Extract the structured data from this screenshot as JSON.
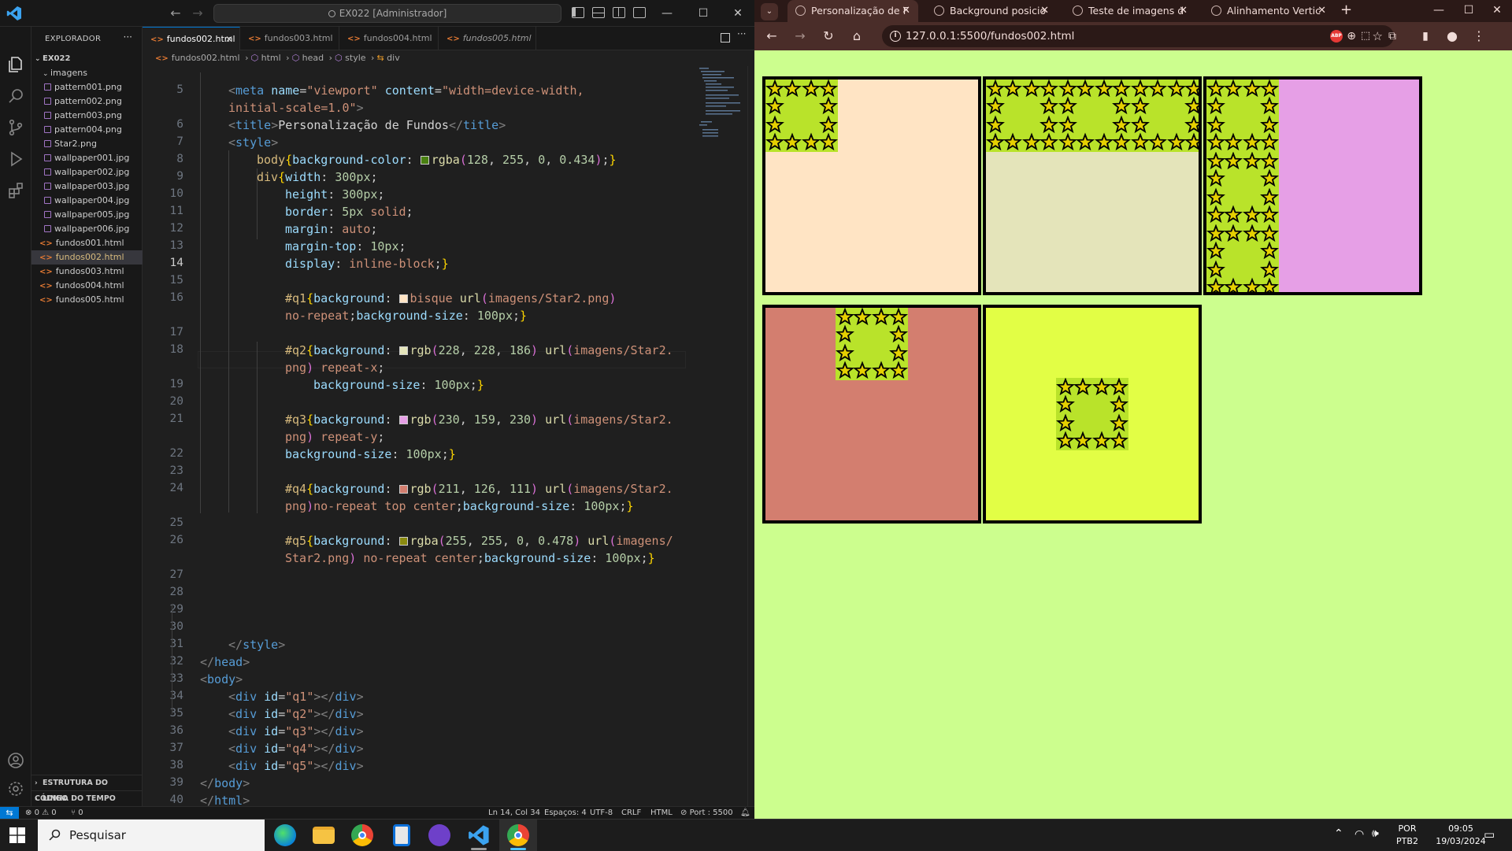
{
  "vscode": {
    "search_label": "EX022 [Administrador]",
    "sidebar": {
      "title": "EXPLORADOR",
      "root": "EX022",
      "folder": "imagens",
      "images": [
        "pattern001.png",
        "pattern002.png",
        "pattern003.png",
        "pattern004.png",
        "Star2.png",
        "wallpaper001.jpg",
        "wallpaper002.jpg",
        "wallpaper003.jpg",
        "wallpaper004.jpg",
        "wallpaper005.jpg",
        "wallpaper006.jpg"
      ],
      "files": [
        "fundos001.html",
        "fundos002.html",
        "fundos003.html",
        "fundos004.html",
        "fundos005.html"
      ],
      "selected_file": "fundos002.html",
      "section_outline": "ESTRUTURA DO CÓDIGO",
      "section_timeline": "LINHA DO TEMPO"
    },
    "tabs": [
      "fundos002.html",
      "fundos003.html",
      "fundos004.html",
      "fundos005.html"
    ],
    "breadcrumb": [
      "fundos002.html",
      "html",
      "head",
      "style",
      "div"
    ],
    "code": {
      "line_numbers": [
        "5",
        "",
        "6",
        "7",
        "8",
        "9",
        "10",
        "11",
        "12",
        "13",
        "14",
        "15",
        "16",
        "",
        "17",
        "18",
        "",
        "19",
        "20",
        "21",
        "",
        "22",
        "23",
        "24",
        "",
        "25",
        "26",
        "",
        "27",
        "28",
        "29",
        "30",
        "31",
        "32",
        "33",
        "34",
        "35",
        "36",
        "37",
        "38",
        "39",
        "40"
      ],
      "current_line": "14"
    },
    "status": {
      "errors": "0",
      "warnings": "0",
      "ports": "0",
      "position": "Ln 14, Col 34",
      "spaces": "Espaços: 4",
      "encoding": "UTF-8",
      "eol": "CRLF",
      "language": "HTML",
      "port": "Port : 5500"
    }
  },
  "chrome": {
    "tabs": [
      "Personalização de F",
      "Background posicio",
      "Teste de imagens d",
      "Alinhamento Vertic"
    ],
    "url": "127.0.0.1:5500/fundos002.html",
    "abp": "ABP",
    "boxes": [
      {
        "id": "q1",
        "color": "#ffe4c4",
        "repeat": "no-repeat",
        "position": "top left"
      },
      {
        "id": "q2",
        "color": "#e4e4ba",
        "repeat": "repeat-x",
        "position": "top left"
      },
      {
        "id": "q3",
        "color": "#e69fe6",
        "repeat": "repeat-y",
        "position": "top left"
      },
      {
        "id": "q4",
        "color": "#d37e6f",
        "repeat": "no-repeat",
        "position": "top center"
      },
      {
        "id": "q5",
        "color": "#e2fe45",
        "repeat": "no-repeat",
        "position": "center"
      }
    ]
  },
  "taskbar": {
    "search_label": "Pesquisar",
    "lang_top": "POR",
    "lang_bottom": "PTB2",
    "time": "09:05",
    "date": "19/03/2024"
  }
}
